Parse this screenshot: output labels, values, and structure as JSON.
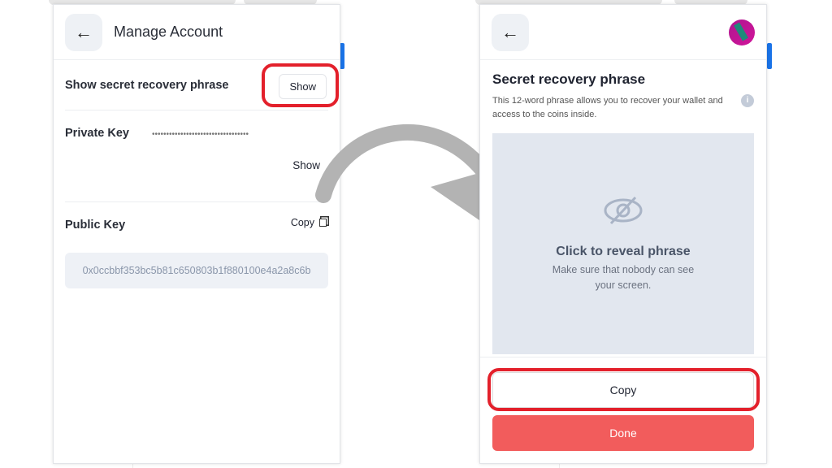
{
  "left": {
    "title": "Manage Account",
    "secret_label": "Show secret recovery phrase",
    "secret_show": "Show",
    "private_key_label": "Private Key",
    "private_key_masked": "••••••••••••••••••••••••••••••••••",
    "private_key_show": "Show",
    "public_key_label": "Public Key",
    "copy_label": "Copy",
    "public_key_value": "0x0ccbbf353bc5b81c650803b1f880100e4a2a8c6b"
  },
  "right": {
    "title": "Secret recovery phrase",
    "description": "This 12-word phrase allows you to recover your wallet and access to the coins inside.",
    "reveal_title": "Click to reveal phrase",
    "reveal_sub": "Make sure that nobody can see your screen.",
    "copy_button": "Copy",
    "done_button": "Done"
  },
  "colors": {
    "highlight": "#e3202b",
    "done": "#f25c5c",
    "arrow": "#b3b3b3"
  }
}
